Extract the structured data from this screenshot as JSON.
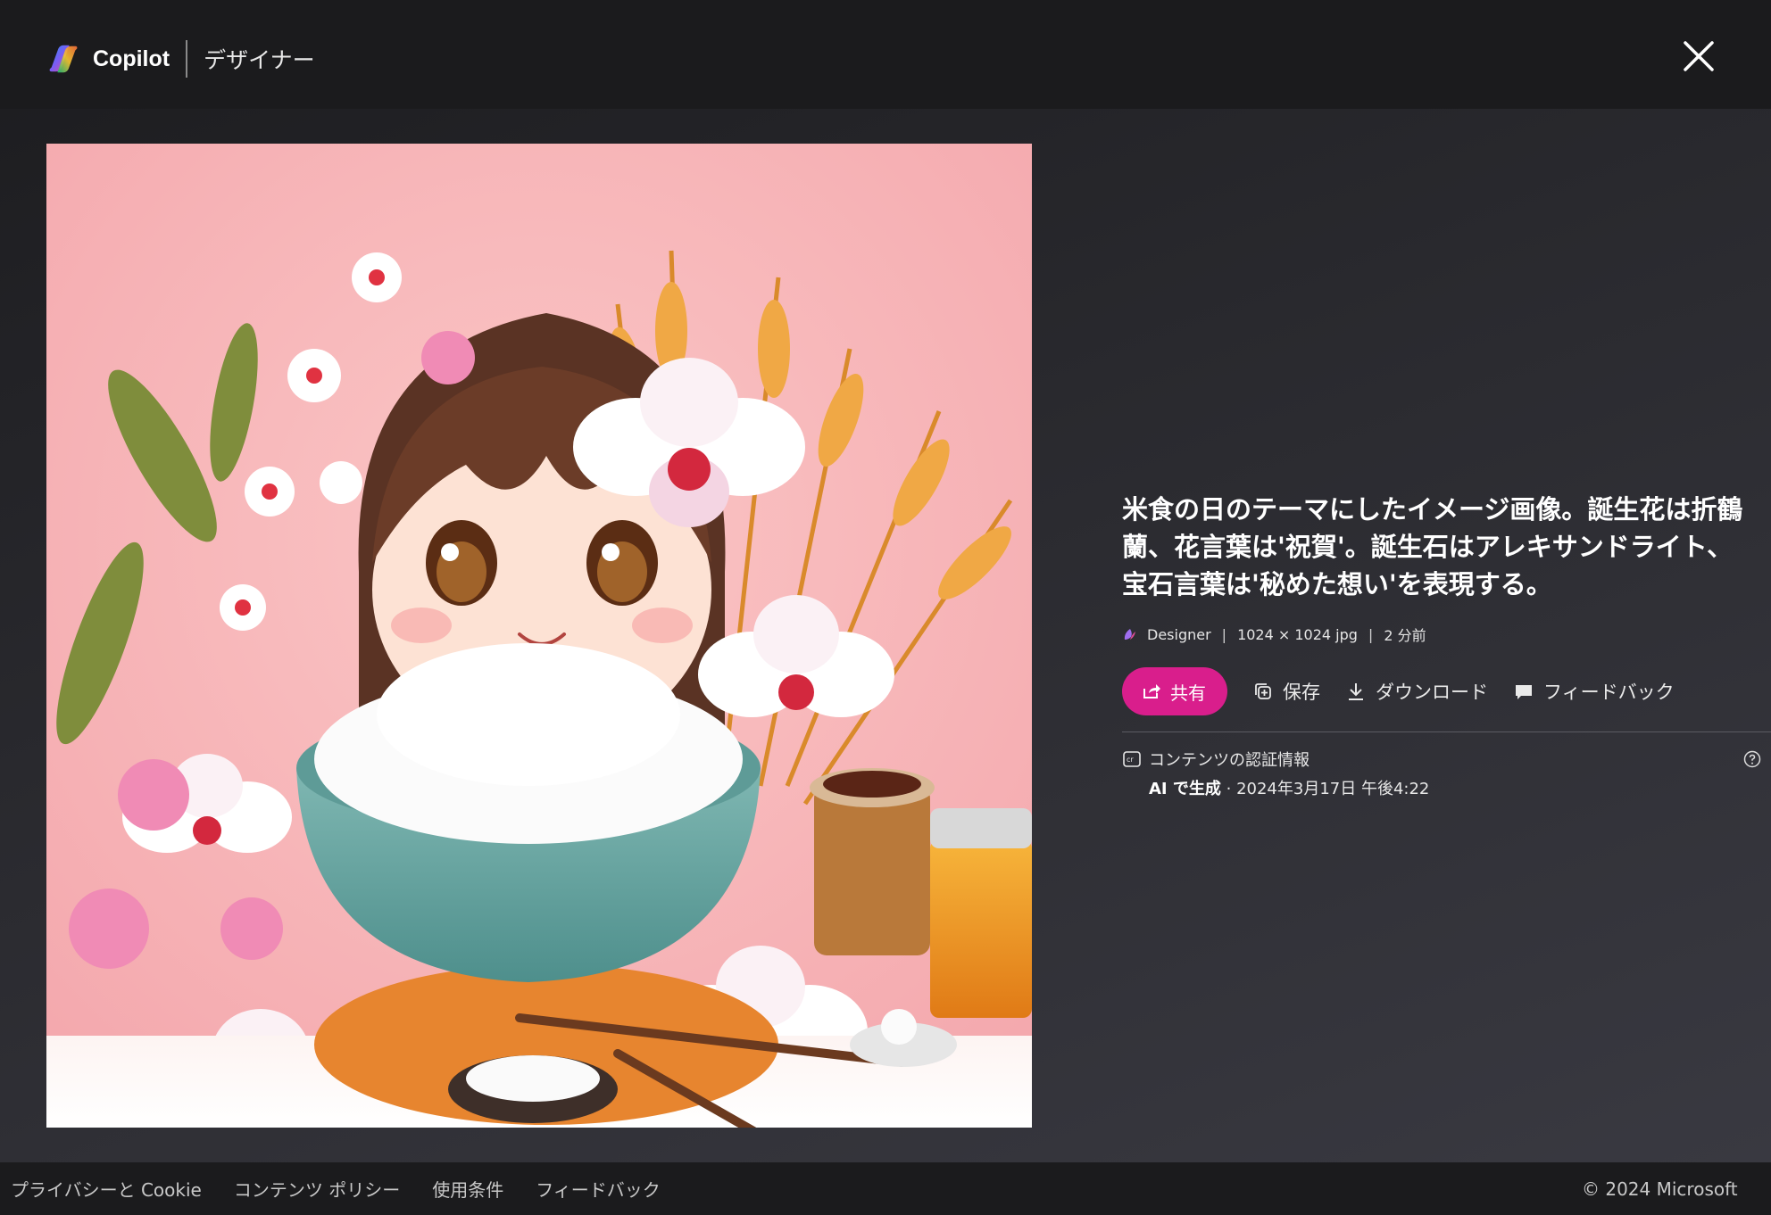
{
  "header": {
    "brand": "Copilot",
    "subbrand": "デザイナー",
    "close_icon": "close-icon"
  },
  "image": {
    "alt": "米食の日のテーマにしたイメージ画像。誕生花は折鶴蘭、花言葉は'祝賀'。誕生石はアレキサンドライト、宝石言葉は'秘めた想い'を表現する。"
  },
  "details": {
    "title": "米食の日のテーマにしたイメージ画像。誕生花は折鶴蘭、花言葉は'祝賀'。誕生石はアレキサンドライト、宝石言葉は'秘めた想い'を表現する。",
    "source": "Designer",
    "size": "1024 × 1024 jpg",
    "time": "2 分前",
    "separator": "|"
  },
  "actions": {
    "share": "共有",
    "save": "保存",
    "download": "ダウンロード",
    "feedback": "フィードバック"
  },
  "credentials": {
    "label": "コンテンツの認証情報",
    "generated": "AI で生成",
    "date": " · 2024年3月17日 午後4:22"
  },
  "footer": {
    "privacy": "プライバシーと Cookie",
    "content_policy": "コンテンツ ポリシー",
    "terms": "使用条件",
    "feedback": "フィードバック",
    "copyright": "© 2024 Microsoft"
  },
  "colors": {
    "accent": "#d91e8c",
    "background": "#1b1b1d"
  }
}
